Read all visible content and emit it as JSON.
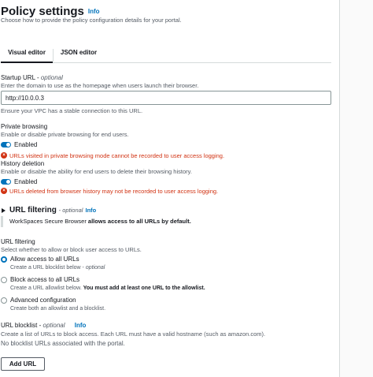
{
  "header": {
    "title": "Policy settings",
    "info": "Info",
    "description": "Choose how to provide the policy configuration details for your portal."
  },
  "tabs": [
    {
      "label": "Visual editor",
      "active": true
    },
    {
      "label": "JSON editor",
      "active": false
    }
  ],
  "startup_url": {
    "label": "Startup URL",
    "optional": "optional",
    "description": "Enter the domain to use as the homepage when users launch their browser.",
    "value": "http://10.0.0.3",
    "hint": "Ensure your VPC has a stable connection to this URL."
  },
  "private_browsing": {
    "label": "Private browsing",
    "description": "Enable or disable private browsing for end users.",
    "toggle_label": "Enabled",
    "enabled": true,
    "warning": "URLs visited in private browsing mode cannot be recorded to user access logging."
  },
  "history_deletion": {
    "label": "History deletion",
    "description": "Enable or disable the ability for end users to delete their browsing history.",
    "toggle_label": "Enabled",
    "enabled": true,
    "warning": "URLs deleted from browser history may not be recorded to user access logging."
  },
  "url_filtering_section": {
    "title": "URL filtering",
    "optional": "optional",
    "info": "Info",
    "alert_prefix": "WorkSpaces Secure Browser ",
    "alert_bold": "allows access to all URLs by default."
  },
  "url_filtering": {
    "label": "URL filtering",
    "description": "Select whether to allow or block user access to URLs.",
    "options": [
      {
        "label": "Allow access to all URLs",
        "desc_prefix": "Create a URL blocklist below - ",
        "desc_em": "optional",
        "desc_bold": "",
        "checked": true
      },
      {
        "label": "Block access to all URLs",
        "desc_prefix": "Create a URL allowlist below. ",
        "desc_em": "",
        "desc_bold": "You must add at least one URL to the allowlist.",
        "checked": false
      },
      {
        "label": "Advanced configuration",
        "desc_prefix": "Create both an allowlist and a blocklist.",
        "desc_em": "",
        "desc_bold": "",
        "checked": false
      }
    ]
  },
  "url_blocklist": {
    "label": "URL blocklist",
    "optional": "optional",
    "info": "Info",
    "description": "Create a list of URLs to block access. Each URL must have a valid hostname (such as amazon.com).",
    "empty_text": "No blocklist URLs associated with the portal.",
    "add_button": "Add URL"
  },
  "colors": {
    "link": "#0073bb",
    "error": "#d13212",
    "text": "#16191f",
    "muted": "#545b64"
  },
  "icons": {
    "warning": "error-circle-icon",
    "caret": "caret-right-icon"
  }
}
